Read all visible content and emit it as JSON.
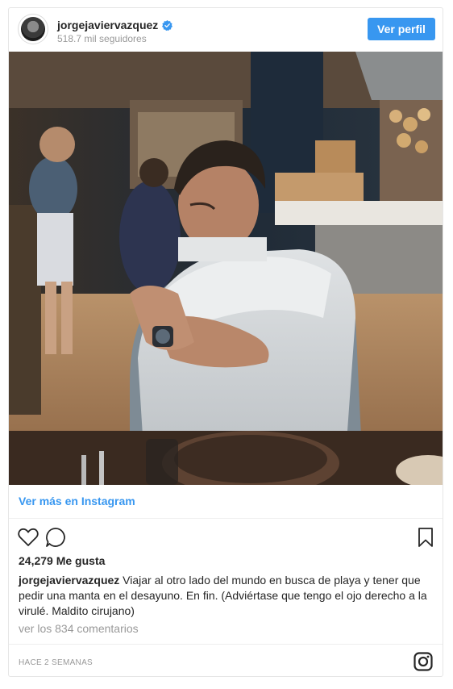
{
  "post": {
    "username": "jorgejaviervazquez",
    "followers": "518.7 mil seguidores",
    "follow_label": "Ver perfil",
    "view_more": "Ver más en Instagram",
    "likes": "24,279 Me gusta",
    "caption_user": "jorgejaviervazquez",
    "caption_text": "Viajar al otro lado del mundo en busca de playa y tener que pedir una manta en el desayuno. En fin. (Adviértase que tengo el ojo derecho a la virulé. Maldito cirujano)",
    "comments": "ver los 834 comentarios",
    "timestamp": "HACE 2 SEMANAS"
  },
  "icons": {
    "like": "heart-icon",
    "comment": "comment-icon",
    "save": "bookmark-icon",
    "verified": "verified-badge-icon",
    "brand": "instagram-logo-icon"
  },
  "colors": {
    "accent": "#3897f0",
    "text": "#262626",
    "muted": "#999999",
    "border": "#e6e6e6"
  }
}
